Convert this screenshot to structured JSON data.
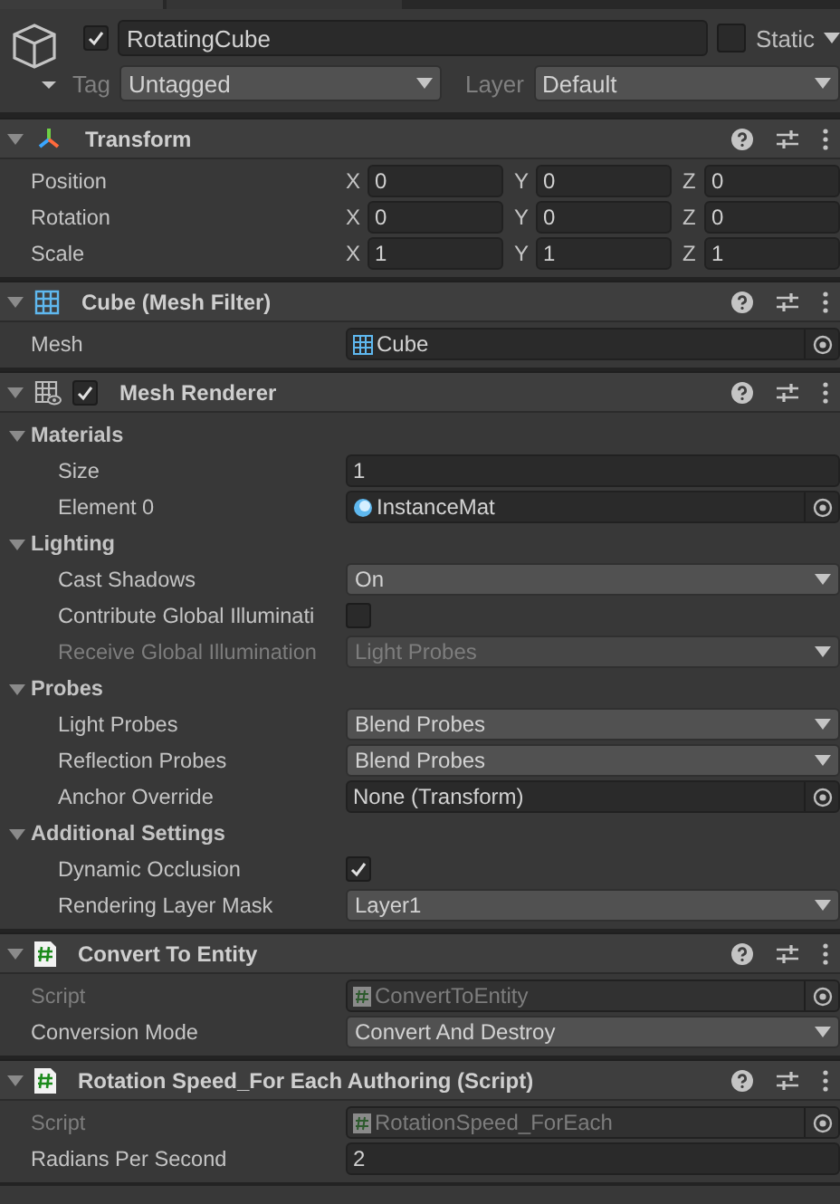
{
  "game_object": {
    "active": true,
    "name": "RotatingCube",
    "is_static": false,
    "static_label": "Static",
    "tag_label": "Tag",
    "tag": "Untagged",
    "layer_label": "Layer",
    "layer": "Default"
  },
  "components": [
    {
      "title": "Transform",
      "kind": "transform",
      "expanded": true,
      "properties": [
        {
          "kind": "vector3",
          "label": "Position",
          "disabled": false,
          "axes": [
            {
              "axis": "X",
              "value": "0"
            },
            {
              "axis": "Y",
              "value": "0"
            },
            {
              "axis": "Z",
              "value": "0"
            }
          ]
        },
        {
          "kind": "vector3",
          "label": "Rotation",
          "disabled": false,
          "axes": [
            {
              "axis": "X",
              "value": "0"
            },
            {
              "axis": "Y",
              "value": "0"
            },
            {
              "axis": "Z",
              "value": "0"
            }
          ]
        },
        {
          "kind": "vector3",
          "label": "Scale",
          "disabled": false,
          "axes": [
            {
              "axis": "X",
              "value": "1"
            },
            {
              "axis": "Y",
              "value": "1"
            },
            {
              "axis": "Z",
              "value": "1"
            }
          ]
        }
      ]
    },
    {
      "title": "Cube (Mesh Filter)",
      "kind": "mesh",
      "expanded": true,
      "properties": [
        {
          "kind": "mesh",
          "label": "Mesh",
          "disabled": false,
          "value": "Cube"
        }
      ]
    },
    {
      "title": "Mesh Renderer",
      "kind": "renderer",
      "enabled": true,
      "expanded": true,
      "properties": [
        {
          "kind": "foldout",
          "label": "Materials",
          "expanded": true,
          "children": [
            {
              "kind": "text",
              "label": "Size",
              "disabled": false,
              "value": "1"
            },
            {
              "kind": "material",
              "label": "Element 0",
              "disabled": false,
              "value": "InstanceMat"
            }
          ]
        },
        {
          "kind": "foldout",
          "label": "Lighting",
          "expanded": true,
          "children": [
            {
              "kind": "dropdown",
              "label": "Cast Shadows",
              "disabled": false,
              "value": "On"
            },
            {
              "kind": "checkbox",
              "label": "Contribute Global Illuminati",
              "disabled": false,
              "checked": false
            },
            {
              "kind": "dropdown",
              "label": "Receive Global Illumination",
              "disabled": true,
              "value": "Light Probes"
            }
          ]
        },
        {
          "kind": "foldout",
          "label": "Probes",
          "expanded": true,
          "children": [
            {
              "kind": "dropdown",
              "label": "Light Probes",
              "disabled": false,
              "value": "Blend Probes"
            },
            {
              "kind": "dropdown",
              "label": "Reflection Probes",
              "disabled": false,
              "value": "Blend Probes"
            },
            {
              "kind": "reference",
              "label": "Anchor Override",
              "disabled": false,
              "value": "None (Transform)"
            }
          ]
        },
        {
          "kind": "foldout",
          "label": "Additional Settings",
          "expanded": true,
          "children": [
            {
              "kind": "checkbox",
              "label": "Dynamic Occlusion",
              "disabled": false,
              "checked": true
            },
            {
              "kind": "dropdown",
              "label": "Rendering Layer Mask",
              "disabled": false,
              "value": "Layer1"
            }
          ]
        }
      ]
    },
    {
      "title": "Convert To Entity",
      "kind": "script",
      "expanded": true,
      "properties": [
        {
          "kind": "script",
          "label": "Script",
          "disabled": true,
          "value": "ConvertToEntity"
        },
        {
          "kind": "dropdown",
          "label": "Conversion Mode",
          "disabled": false,
          "value": "Convert And Destroy"
        }
      ]
    },
    {
      "title": "Rotation Speed_For Each Authoring (Script)",
      "kind": "script",
      "expanded": true,
      "properties": [
        {
          "kind": "script",
          "label": "Script",
          "disabled": true,
          "value": "RotationSpeed_ForEach"
        },
        {
          "kind": "text",
          "label": "Radians Per Second",
          "disabled": false,
          "value": "2"
        }
      ]
    }
  ]
}
